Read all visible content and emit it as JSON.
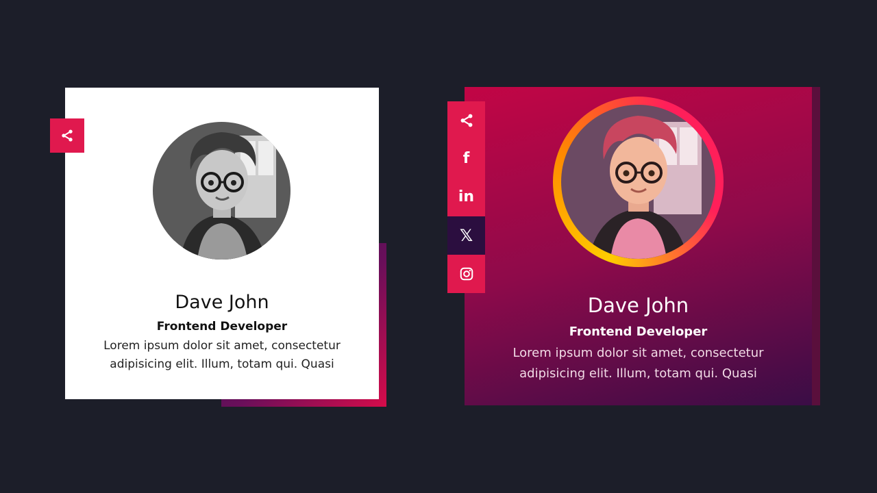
{
  "colors": {
    "background": "#1c1e29",
    "accent": "#e0194e",
    "active_social": "#2b0e3f",
    "card2_top": "#c20545",
    "card2_bottom": "#3a0d46"
  },
  "cards": [
    {
      "name": "Dave John",
      "role": "Frontend Developer",
      "description": "Lorem ipsum dolor sit amet, consectetur adipisicing elit. Illum, totam qui. Quasi",
      "share_icon": "share-icon"
    },
    {
      "name": "Dave John",
      "role": "Frontend Developer",
      "description": "Lorem ipsum dolor sit amet, consectetur adipisicing elit. Illum, totam qui. Quasi",
      "social": [
        {
          "icon": "share-icon"
        },
        {
          "icon": "facebook-icon",
          "glyph": "f"
        },
        {
          "icon": "linkedin-icon",
          "glyph": "in"
        },
        {
          "icon": "x-icon",
          "glyph": "𝕏"
        },
        {
          "icon": "instagram-icon"
        }
      ]
    }
  ]
}
